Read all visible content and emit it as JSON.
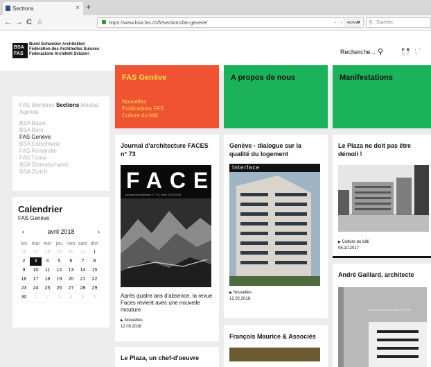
{
  "browser": {
    "tab_title": "Sections",
    "tab_close": "×",
    "new_tab": "+",
    "url": "https://www.bsa-fas.ch/fr/sections/fas-geneve/",
    "zoom": "90%",
    "search_placeholder": "Suchen",
    "back_icon": "←",
    "forward_icon": "→",
    "reload_icon": "C",
    "home_icon": "⌂",
    "toolbar_icons": "··· ♥ ☆"
  },
  "header": {
    "logo_mark_line1": "BSA",
    "logo_mark_line2": "FAS",
    "logo_line1": "Bund Schweizer Architekten",
    "logo_line2": "Fédération des Architectes Suisses",
    "logo_line3": "Federazione Architetti Svizzeri",
    "search_label": "Recherche...",
    "search_icon": "magnifier-icon",
    "lang_fr": "FR",
    "lang_it": "IT",
    "lang_de": "DE",
    "lang_more": "T"
  },
  "sidebar": {
    "nav_fas": "FAS",
    "nav_membres": "Membres",
    "nav_sections": "Sections",
    "nav_medias": "Médias",
    "nav_agenda": "Agenda",
    "sections": [
      "BSA Basel",
      "BSA Bern",
      "FAS Genève",
      "BSA Ostschweiz",
      "FAS Romandie",
      "FAS Ticino",
      "BSA Zentralschweiz",
      "BSA Zürich"
    ],
    "active_section": "FAS Genève"
  },
  "calendar": {
    "title": "Calendrier",
    "subtitle": "FAS Genève",
    "month": "avril 2018",
    "prev": "‹",
    "next": "›",
    "weekdays": [
      "lun",
      "mar",
      "mer",
      "jeu",
      "ven",
      "sam",
      "dim"
    ],
    "weeks": [
      [
        "26",
        "27",
        "28",
        "29",
        "30",
        "31",
        "1"
      ],
      [
        "2",
        "3",
        "4",
        "5",
        "6",
        "7",
        "8"
      ],
      [
        "9",
        "10",
        "11",
        "12",
        "13",
        "14",
        "15"
      ],
      [
        "16",
        "17",
        "18",
        "19",
        "20",
        "21",
        "22"
      ],
      [
        "23",
        "24",
        "25",
        "26",
        "27",
        "28",
        "29"
      ],
      [
        "30",
        "1",
        "2",
        "3",
        "4",
        "5",
        "6"
      ]
    ],
    "today": "3"
  },
  "banners": {
    "geneve_title": "FAS Genève",
    "geneve_links": [
      "Nouvelles",
      "Publications FAS",
      "Culture du bâti"
    ],
    "apropos_title": "A propos de nous",
    "manif_title": "Manifestations"
  },
  "cards": {
    "faces": {
      "title": "Journal d'architecture FACES n° 73",
      "cover_word": "FACES",
      "cover_sub": "Journal d'architecture n° 73 | Hiver 2017/2018",
      "text": "Après quatre ans d'absence, la revue Faces revient avec une nouvelle mouture",
      "category": "Nouvelles",
      "date": "12.03.2018"
    },
    "geneve_dialogue": {
      "title": "Genève - dialogue sur la qualité du logement",
      "cover_label": "Interface",
      "category": "Nouvelles",
      "date": "12.02.2018"
    },
    "plaza": {
      "title": "Le Plaza ne doit pas être démoli !",
      "category": "Culture du bâti",
      "date": "06.10.2017"
    },
    "gaillard": {
      "title": "André Gaillard, architecte",
      "cover_text": "ANDRÉ GAILLARD ARCHITECTE"
    },
    "maurice": {
      "title": "François Maurice & Associés"
    },
    "plaza2": {
      "title": "Le Plaza, un chef-d'oeuvre"
    }
  },
  "colors": {
    "red": "#ef5331",
    "green": "#1bb35a",
    "yellow": "#ffd84a"
  }
}
